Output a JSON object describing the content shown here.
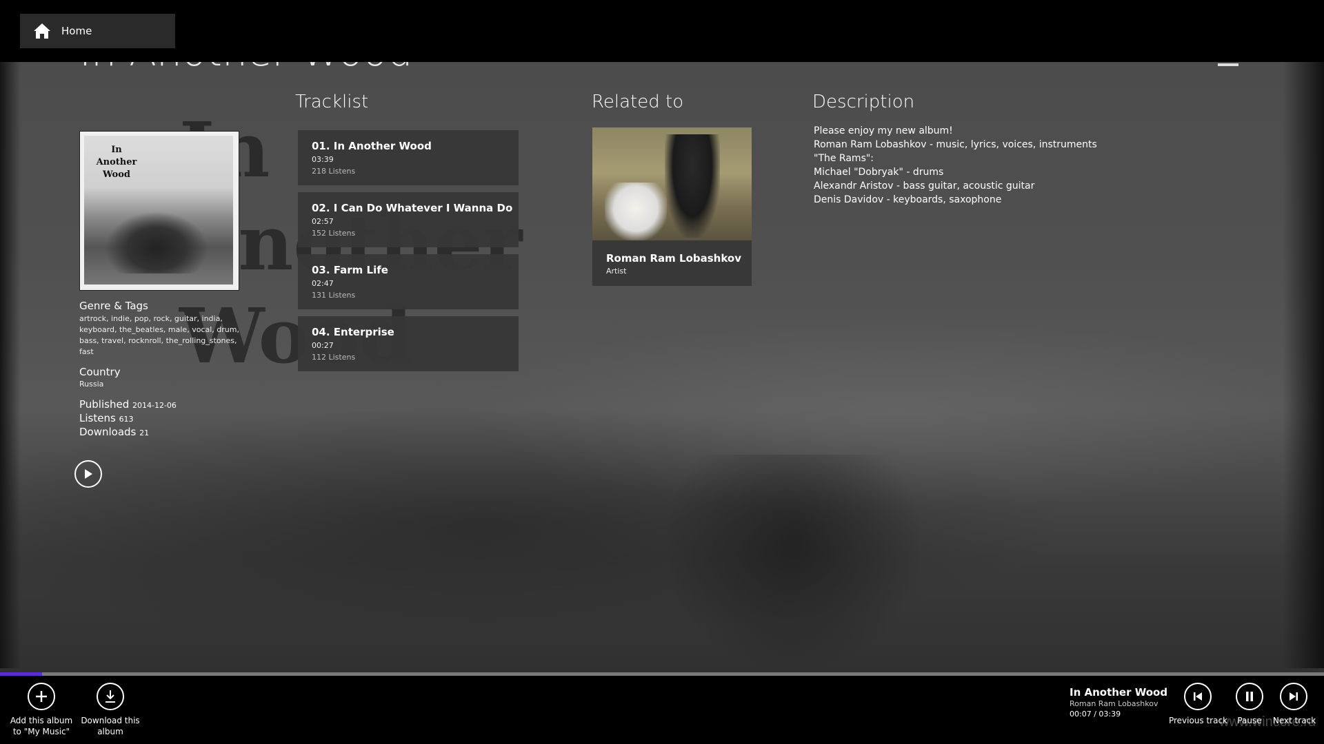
{
  "topbar": {
    "home_label": "Home"
  },
  "page_title": "In Another Wood",
  "background": {
    "big_title": "In Another Wood"
  },
  "cover": {
    "text": "In Another Wood"
  },
  "info": {
    "genre_label": "Genre & Tags",
    "genre_tags": "artrock, indie, pop, rock, guitar, india, keyboard, the_beatles, male, vocal, drum, bass, travel, rocknroll, the_rolling_stones, fast",
    "country_label": "Country",
    "country_value": "Russia",
    "published_label": "Published",
    "published_value": "2014-12-06",
    "listens_label": "Listens",
    "listens_value": "613",
    "downloads_label": "Downloads",
    "downloads_value": "21"
  },
  "sections": {
    "tracklist": "Tracklist",
    "related": "Related to",
    "description": "Description"
  },
  "tracks": [
    {
      "title": "01. In Another Wood",
      "duration": "03:39",
      "listens": "218 Listens"
    },
    {
      "title": "02. I Can Do Whatever I Wanna Do",
      "duration": "02:57",
      "listens": "152 Listens"
    },
    {
      "title": "03. Farm Life",
      "duration": "02:47",
      "listens": "131 Listens"
    },
    {
      "title": "04. Enterprise",
      "duration": "00:27",
      "listens": "112 Listens"
    }
  ],
  "related": {
    "name": "Roman Ram Lobashkov",
    "role": "Artist"
  },
  "description": {
    "lines": [
      "Please enjoy my new album!",
      "Roman Ram Lobashkov - music, lyrics, voices, instruments",
      "\"The Rams\":",
      "Michael \"Dobryak\" - drums",
      "Alexandr Aristov - bass guitar, acoustic guitar",
      "Denis Davidov - keyboards, saxophone"
    ]
  },
  "player": {
    "add_label_1": "Add this album",
    "add_label_2": "to \"My Music\"",
    "download_label_1": "Download this",
    "download_label_2": "album",
    "now_title": "In Another Wood",
    "now_artist": "Roman Ram Lobashkov",
    "now_time": "00:07 / 03:39",
    "progress": 0.032,
    "prev_label": "Previous track",
    "pause_label": "Pause",
    "next_label": "Next track",
    "accent_color": "#5a2dd6"
  },
  "watermark": "www.wincore.ru",
  "icons": [
    "home-icon",
    "back-icon",
    "menu-icon",
    "play-icon",
    "add-icon",
    "download-icon",
    "previous-icon",
    "pause-icon",
    "next-icon"
  ]
}
